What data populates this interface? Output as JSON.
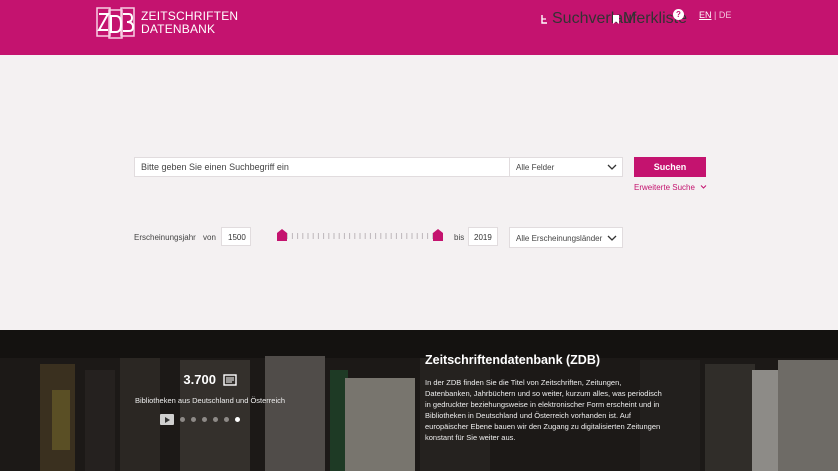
{
  "header": {
    "logo_line1": "ZEITSCHRIFTEN",
    "logo_line2": "DATENBANK",
    "search_history": "Suchverlauf",
    "bookmarks": "Merkliste",
    "help": "?",
    "lang_en": "EN",
    "lang_sep": "|",
    "lang_de": "DE"
  },
  "search": {
    "placeholder": "Bitte geben Sie einen Suchbegriff ein",
    "field_select": "Alle Felder",
    "button": "Suchen",
    "advanced": "Erweiterte Suche"
  },
  "year_filter": {
    "label": "Erscheinungsjahr",
    "from_label": "von",
    "from_value": "1500",
    "to_label": "bis",
    "to_value": "2019",
    "country_select": "Alle Erscheinungsländer",
    "range_min_fraction": 0.0,
    "range_max_fraction": 1.0
  },
  "banner": {
    "stat_value": "3.700",
    "stat_caption": "Bibliotheken aus Deutschland und Österreich",
    "slides_count": 6,
    "active_slide": 6,
    "title": "Zeitschriftendatenbank (ZDB)",
    "body": "In der ZDB finden Sie die Titel von Zeitschriften, Zeitungen, Datenbanken, Jahrbüchern und so weiter, kurzum alles, was periodisch in gedruckter beziehungsweise in elektronischer Form erscheint und in Bibliotheken in Deutschland und Österreich vorhanden ist. Auf europäischer Ebene bauen wir den Zugang zu digitalisierten Zeitungen konstant für Sie weiter aus."
  },
  "colors": {
    "brand": "#c4136f",
    "page_bg": "#f4f1f2",
    "banner_bg": "#2a2623"
  }
}
